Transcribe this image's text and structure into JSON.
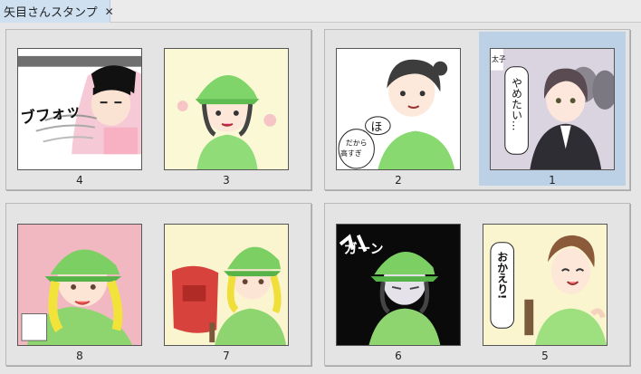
{
  "tab": {
    "title": "矢目さんスタンプ",
    "close_glyph": "✕"
  },
  "spreads": [
    {
      "pages": [
        {
          "number": "4"
        },
        {
          "number": "3"
        }
      ]
    },
    {
      "pages": [
        {
          "number": "2",
          "texts": [
            "ほ",
            "だから",
            "高すぎ"
          ]
        },
        {
          "number": "1",
          "selected": true,
          "texts": [
            "太子",
            "やめたい…"
          ]
        }
      ]
    },
    {
      "pages": [
        {
          "number": "8"
        },
        {
          "number": "7"
        }
      ]
    },
    {
      "pages": [
        {
          "number": "6"
        },
        {
          "number": "5",
          "texts": [
            "おかえり!"
          ]
        }
      ]
    }
  ],
  "thumb_texts": {
    "page4_sfx": "ブフォッ",
    "page6_sfx": "ガーン"
  }
}
